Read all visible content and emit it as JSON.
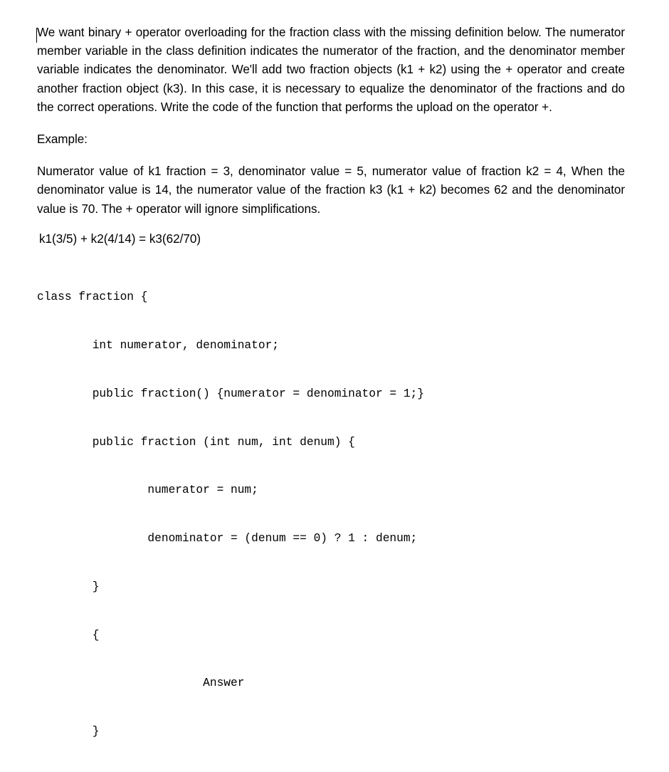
{
  "document": {
    "background_color": "#ffffff",
    "text_color": "#000000",
    "caret_visible": true,
    "paragraphs": {
      "prompt": "We want binary + operator overloading for the fraction class with the missing definition below. The numerator member variable in the class definition indicates the numerator of the fraction, and the denominator member variable indicates the denominator. We'll add two fraction objects (k1 + k2) using the + operator and create another fraction object (k3). In this case, it is necessary to equalize the denominator of the fractions and do the correct operations. Write the code of the function that performs the upload on the operator +.",
      "example_heading": "Example:",
      "example_body": "Numerator value of k1 fraction = 3, denominator value = 5, numerator value of fraction k2 = 4, When the denominator value is 14, the numerator value of the fraction k3 (k1 + k2) becomes 62 and the denominator value is 70. The + operator will ignore simplifications.",
      "equation": "k1(3/5) + k2(4/14) = k3(62/70)"
    },
    "code": {
      "language": "java",
      "lines": [
        "class fraction {",
        "        int numerator, denominator;",
        "        public fraction() {numerator = denominator = 1;}",
        "        public fraction (int num, int denum) {",
        "                numerator = num;",
        "                denominator = (denum == 0) ? 1 : denum;",
        "        }",
        "        {",
        "                        Answer",
        "        }"
      ]
    }
  }
}
